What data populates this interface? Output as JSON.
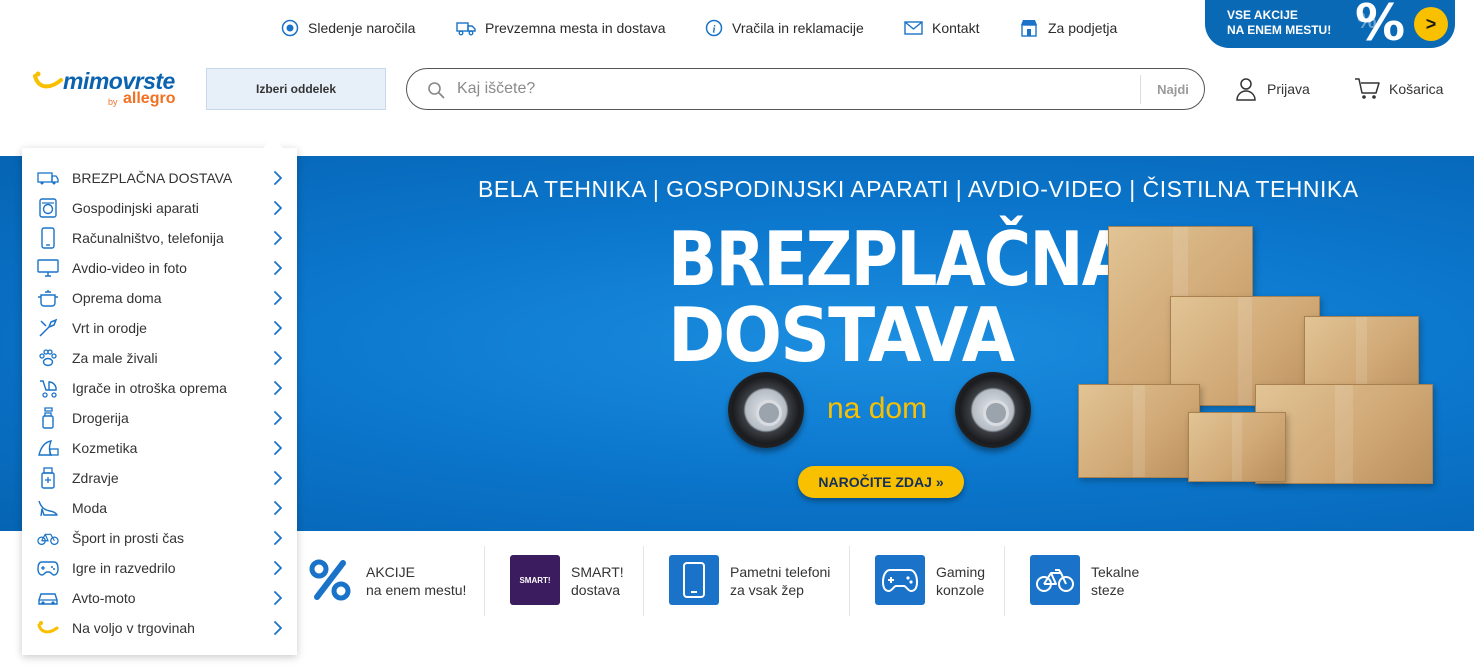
{
  "topnav": {
    "links": [
      {
        "label": "Sledenje naročila",
        "icon": "target-icon"
      },
      {
        "label": "Prevzemna mesta in dostava",
        "icon": "truck-icon"
      },
      {
        "label": "Vračila in reklamacije",
        "icon": "info-icon"
      },
      {
        "label": "Kontakt",
        "icon": "envelope-icon"
      },
      {
        "label": "Za podjetja",
        "icon": "store-icon"
      }
    ],
    "promo": {
      "line1": "VSE AKCIJE",
      "line2": "NA ENEM MESTU!",
      "symbol": "%",
      "arrow": ">"
    }
  },
  "header": {
    "logo": {
      "word": "mimovrste",
      "by": "by",
      "brand": "allegro"
    },
    "department_label": "Izberi oddelek",
    "search": {
      "placeholder": "Kaj iščete?",
      "button": "Najdi"
    },
    "login": "Prijava",
    "cart": "Košarica"
  },
  "sidebar": {
    "items": [
      {
        "label": "BREZPLAČNA DOSTAVA",
        "icon": "free-delivery-icon"
      },
      {
        "label": "Gospodinjski aparati",
        "icon": "washing-machine-icon"
      },
      {
        "label": "Računalništvo, telefonija",
        "icon": "phone-icon"
      },
      {
        "label": "Avdio-video in foto",
        "icon": "monitor-icon"
      },
      {
        "label": "Oprema doma",
        "icon": "pot-icon"
      },
      {
        "label": "Vrt in orodje",
        "icon": "tools-icon"
      },
      {
        "label": "Za male živali",
        "icon": "paw-icon"
      },
      {
        "label": "Igrače in otroška oprema",
        "icon": "stroller-icon"
      },
      {
        "label": "Drogerija",
        "icon": "spray-bottle-icon"
      },
      {
        "label": "Kozmetika",
        "icon": "cosmetics-icon"
      },
      {
        "label": "Zdravje",
        "icon": "pill-bottle-icon"
      },
      {
        "label": "Moda",
        "icon": "high-heel-icon"
      },
      {
        "label": "Šport in prosti čas",
        "icon": "bicycle-icon"
      },
      {
        "label": "Igre in razvedrilo",
        "icon": "gamepad-icon"
      },
      {
        "label": "Avto-moto",
        "icon": "car-icon"
      },
      {
        "label": "Na voljo v trgovinah",
        "icon": "store-logo-icon"
      }
    ]
  },
  "hero": {
    "categories": "BELA TEHNIKA | GOSPODINJSKI APARATI | AVDIO-VIDEO | ČISTILNA TEHNIKA",
    "headline1": "BREZPLAČNA",
    "headline2": "DOSTAVA",
    "subline": "na dom",
    "cta": "NAROČITE ZDAJ »"
  },
  "tiles": [
    {
      "line1": "AKCIJE",
      "line2": "na enem mestu!",
      "icon": "percent-icon"
    },
    {
      "line1": "SMART!",
      "line2": "dostava",
      "icon": "smart-badge-icon",
      "badge": "SMART!"
    },
    {
      "line1": "Pametni telefoni",
      "line2": "za vsak žep",
      "icon": "smartphone-icon"
    },
    {
      "line1": "Gaming",
      "line2": "konzole",
      "icon": "gamepad-icon"
    },
    {
      "line1": "Tekalne",
      "line2": "steze",
      "icon": "bicycle-icon"
    }
  ],
  "colors": {
    "brand_blue": "#0b76cc",
    "accent_yellow": "#f9c000",
    "allegro_orange": "#f37021",
    "icon_blue": "#1a73c8",
    "smart_purple": "#3b1c5e"
  }
}
